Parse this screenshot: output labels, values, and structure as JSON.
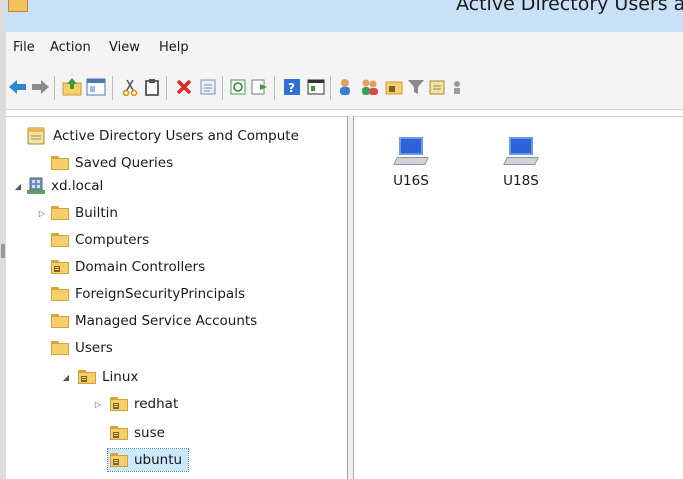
{
  "window": {
    "title": "Active Directory Users a"
  },
  "menu": [
    "File",
    "Action",
    "View",
    "Help"
  ],
  "toolbar": {
    "icons": [
      "back-arrow-icon",
      "forward-arrow-icon",
      "up-folder-icon",
      "show-console-tree-icon",
      "cut-icon",
      "copy-icon",
      "delete-icon",
      "properties-icon",
      "refresh-icon",
      "export-list-icon",
      "help-icon",
      "console-icon",
      "new-user-icon",
      "new-group-icon",
      "new-ou-icon",
      "filter-icon",
      "add-to-group-icon",
      "more-icon"
    ]
  },
  "tree": {
    "root": "Active Directory Users and Compute",
    "items": [
      {
        "label": "Saved Queries",
        "type": "folder"
      },
      {
        "label": "xd.local",
        "type": "domain",
        "expanded": true
      },
      {
        "label": "Builtin",
        "type": "folder",
        "collapsed": true
      },
      {
        "label": "Computers",
        "type": "folder"
      },
      {
        "label": "Domain Controllers",
        "type": "ou"
      },
      {
        "label": "ForeignSecurityPrincipals",
        "type": "folder"
      },
      {
        "label": "Managed Service Accounts",
        "type": "folder"
      },
      {
        "label": "Users",
        "type": "folder"
      },
      {
        "label": "Linux",
        "type": "ou",
        "expanded": true
      },
      {
        "label": "redhat",
        "type": "ou",
        "collapsed": true
      },
      {
        "label": "suse",
        "type": "ou"
      },
      {
        "label": "ubuntu",
        "type": "ou",
        "selected": true
      }
    ]
  },
  "list": {
    "items": [
      {
        "label": "U16S",
        "icon": "computer-icon"
      },
      {
        "label": "U18S",
        "icon": "computer-icon"
      }
    ]
  },
  "colors": {
    "titlebar": "#c9e1f6",
    "selection": "#cce8ff",
    "folder": "#f6cf6a"
  }
}
